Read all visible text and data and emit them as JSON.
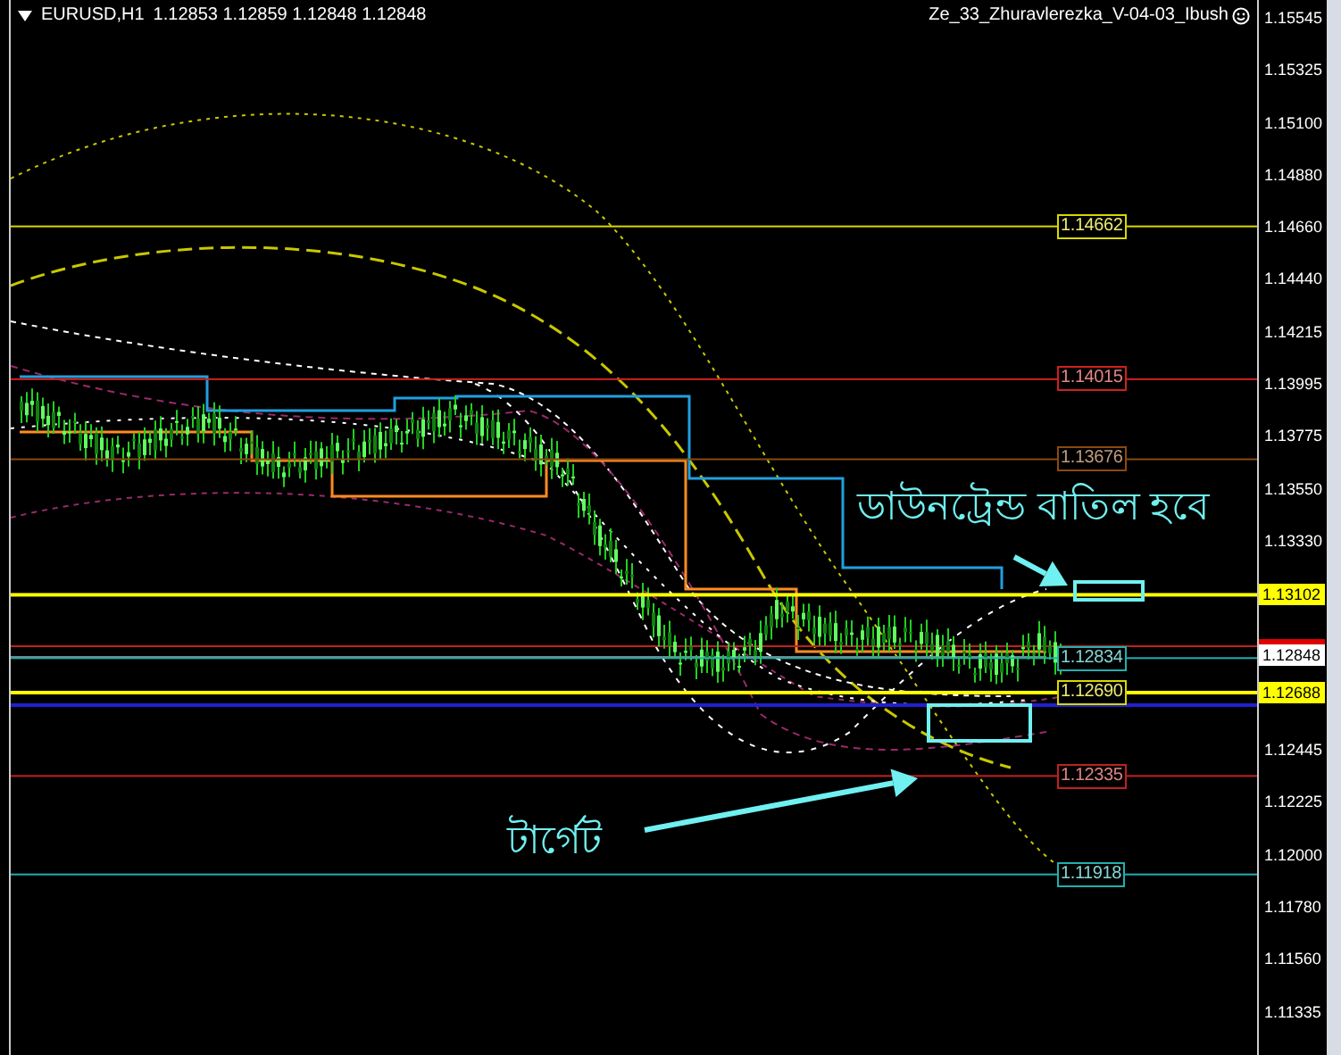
{
  "header": {
    "symbol": "EURUSD,H1",
    "prices": "1.12853 1.12859 1.12848 1.12848",
    "indicator": "Ze_33_Zhuravlerezka_V-04-03_Ibush"
  },
  "price_axis": {
    "ticks": [
      "1.15545",
      "1.15325",
      "1.15100",
      "1.14880",
      "1.14660",
      "1.14440",
      "1.14215",
      "1.13995",
      "1.13775",
      "1.13550",
      "1.13330",
      "1.12445",
      "1.12225",
      "1.12000",
      "1.11780",
      "1.11560",
      "1.11335"
    ],
    "markers": [
      {
        "label": "1.13102",
        "kind": "level",
        "color": "#ffff00"
      },
      {
        "label": "1.12848",
        "kind": "current",
        "color": "#ffffff"
      },
      {
        "label": "1.12688",
        "kind": "level",
        "color": "#ffff00"
      }
    ]
  },
  "levels": [
    {
      "label": "1.14662",
      "color": "#d8d800"
    },
    {
      "label": "1.14015",
      "color": "#d02020"
    },
    {
      "label": "1.13676",
      "color": "#8a4a10"
    },
    {
      "label": "1.12834",
      "color": "#20b0b0"
    },
    {
      "label": "1.12690",
      "color": "#d8d800"
    },
    {
      "label": "1.12335",
      "color": "#c02020"
    },
    {
      "label": "1.11918",
      "color": "#20b0b0"
    }
  ],
  "annotations": [
    {
      "text": "ডাউনট্রেন্ড বাতিল হবে",
      "kind": "upper"
    },
    {
      "text": "টার্গেট",
      "kind": "lower"
    }
  ]
}
